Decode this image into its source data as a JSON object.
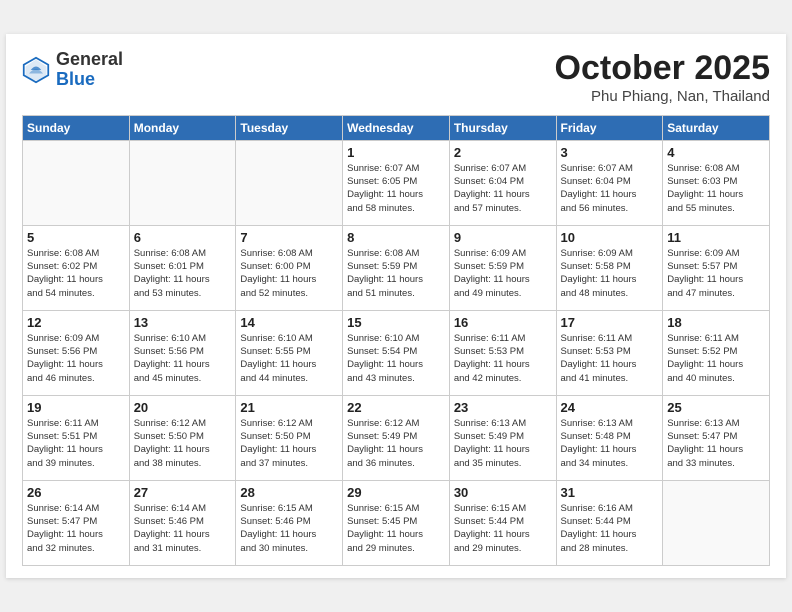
{
  "header": {
    "logo_general": "General",
    "logo_blue": "Blue",
    "month": "October 2025",
    "location": "Phu Phiang, Nan, Thailand"
  },
  "weekdays": [
    "Sunday",
    "Monday",
    "Tuesday",
    "Wednesday",
    "Thursday",
    "Friday",
    "Saturday"
  ],
  "weeks": [
    [
      {
        "day": "",
        "info": ""
      },
      {
        "day": "",
        "info": ""
      },
      {
        "day": "",
        "info": ""
      },
      {
        "day": "1",
        "info": "Sunrise: 6:07 AM\nSunset: 6:05 PM\nDaylight: 11 hours\nand 58 minutes."
      },
      {
        "day": "2",
        "info": "Sunrise: 6:07 AM\nSunset: 6:04 PM\nDaylight: 11 hours\nand 57 minutes."
      },
      {
        "day": "3",
        "info": "Sunrise: 6:07 AM\nSunset: 6:04 PM\nDaylight: 11 hours\nand 56 minutes."
      },
      {
        "day": "4",
        "info": "Sunrise: 6:08 AM\nSunset: 6:03 PM\nDaylight: 11 hours\nand 55 minutes."
      }
    ],
    [
      {
        "day": "5",
        "info": "Sunrise: 6:08 AM\nSunset: 6:02 PM\nDaylight: 11 hours\nand 54 minutes."
      },
      {
        "day": "6",
        "info": "Sunrise: 6:08 AM\nSunset: 6:01 PM\nDaylight: 11 hours\nand 53 minutes."
      },
      {
        "day": "7",
        "info": "Sunrise: 6:08 AM\nSunset: 6:00 PM\nDaylight: 11 hours\nand 52 minutes."
      },
      {
        "day": "8",
        "info": "Sunrise: 6:08 AM\nSunset: 5:59 PM\nDaylight: 11 hours\nand 51 minutes."
      },
      {
        "day": "9",
        "info": "Sunrise: 6:09 AM\nSunset: 5:59 PM\nDaylight: 11 hours\nand 49 minutes."
      },
      {
        "day": "10",
        "info": "Sunrise: 6:09 AM\nSunset: 5:58 PM\nDaylight: 11 hours\nand 48 minutes."
      },
      {
        "day": "11",
        "info": "Sunrise: 6:09 AM\nSunset: 5:57 PM\nDaylight: 11 hours\nand 47 minutes."
      }
    ],
    [
      {
        "day": "12",
        "info": "Sunrise: 6:09 AM\nSunset: 5:56 PM\nDaylight: 11 hours\nand 46 minutes."
      },
      {
        "day": "13",
        "info": "Sunrise: 6:10 AM\nSunset: 5:56 PM\nDaylight: 11 hours\nand 45 minutes."
      },
      {
        "day": "14",
        "info": "Sunrise: 6:10 AM\nSunset: 5:55 PM\nDaylight: 11 hours\nand 44 minutes."
      },
      {
        "day": "15",
        "info": "Sunrise: 6:10 AM\nSunset: 5:54 PM\nDaylight: 11 hours\nand 43 minutes."
      },
      {
        "day": "16",
        "info": "Sunrise: 6:11 AM\nSunset: 5:53 PM\nDaylight: 11 hours\nand 42 minutes."
      },
      {
        "day": "17",
        "info": "Sunrise: 6:11 AM\nSunset: 5:53 PM\nDaylight: 11 hours\nand 41 minutes."
      },
      {
        "day": "18",
        "info": "Sunrise: 6:11 AM\nSunset: 5:52 PM\nDaylight: 11 hours\nand 40 minutes."
      }
    ],
    [
      {
        "day": "19",
        "info": "Sunrise: 6:11 AM\nSunset: 5:51 PM\nDaylight: 11 hours\nand 39 minutes."
      },
      {
        "day": "20",
        "info": "Sunrise: 6:12 AM\nSunset: 5:50 PM\nDaylight: 11 hours\nand 38 minutes."
      },
      {
        "day": "21",
        "info": "Sunrise: 6:12 AM\nSunset: 5:50 PM\nDaylight: 11 hours\nand 37 minutes."
      },
      {
        "day": "22",
        "info": "Sunrise: 6:12 AM\nSunset: 5:49 PM\nDaylight: 11 hours\nand 36 minutes."
      },
      {
        "day": "23",
        "info": "Sunrise: 6:13 AM\nSunset: 5:49 PM\nDaylight: 11 hours\nand 35 minutes."
      },
      {
        "day": "24",
        "info": "Sunrise: 6:13 AM\nSunset: 5:48 PM\nDaylight: 11 hours\nand 34 minutes."
      },
      {
        "day": "25",
        "info": "Sunrise: 6:13 AM\nSunset: 5:47 PM\nDaylight: 11 hours\nand 33 minutes."
      }
    ],
    [
      {
        "day": "26",
        "info": "Sunrise: 6:14 AM\nSunset: 5:47 PM\nDaylight: 11 hours\nand 32 minutes."
      },
      {
        "day": "27",
        "info": "Sunrise: 6:14 AM\nSunset: 5:46 PM\nDaylight: 11 hours\nand 31 minutes."
      },
      {
        "day": "28",
        "info": "Sunrise: 6:15 AM\nSunset: 5:46 PM\nDaylight: 11 hours\nand 30 minutes."
      },
      {
        "day": "29",
        "info": "Sunrise: 6:15 AM\nSunset: 5:45 PM\nDaylight: 11 hours\nand 29 minutes."
      },
      {
        "day": "30",
        "info": "Sunrise: 6:15 AM\nSunset: 5:44 PM\nDaylight: 11 hours\nand 29 minutes."
      },
      {
        "day": "31",
        "info": "Sunrise: 6:16 AM\nSunset: 5:44 PM\nDaylight: 11 hours\nand 28 minutes."
      },
      {
        "day": "",
        "info": ""
      }
    ]
  ]
}
